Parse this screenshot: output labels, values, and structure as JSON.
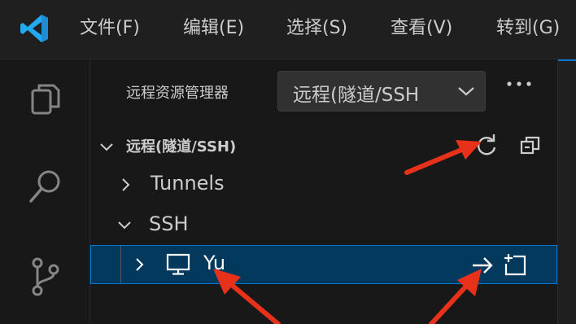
{
  "menu": {
    "file": "文件(F)",
    "edit": "编辑(E)",
    "selection": "选择(S)",
    "view": "查看(V)",
    "go": "转到(G)"
  },
  "sidebar": {
    "title": "远程资源管理器",
    "remote_select_value": "远程(隧道/SSH",
    "section_title": "远程(隧道/SSH)",
    "items": [
      {
        "label": "Tunnels",
        "expanded": false
      },
      {
        "label": "SSH",
        "expanded": true
      },
      {
        "label": "Yu",
        "expanded": false,
        "selected": true
      }
    ]
  },
  "colors": {
    "accent": "#0078d4",
    "selection_bg": "#04395e",
    "annotation_arrow": "#e8311a",
    "logo": "#23a9f2"
  },
  "icons": {
    "activity": [
      "files-icon",
      "search-icon",
      "source-control-icon"
    ],
    "section_actions": [
      "refresh-icon",
      "collapse-all-icon"
    ],
    "row_actions": [
      "connect-arrow-icon",
      "new-window-icon"
    ],
    "host": "monitor-icon"
  }
}
